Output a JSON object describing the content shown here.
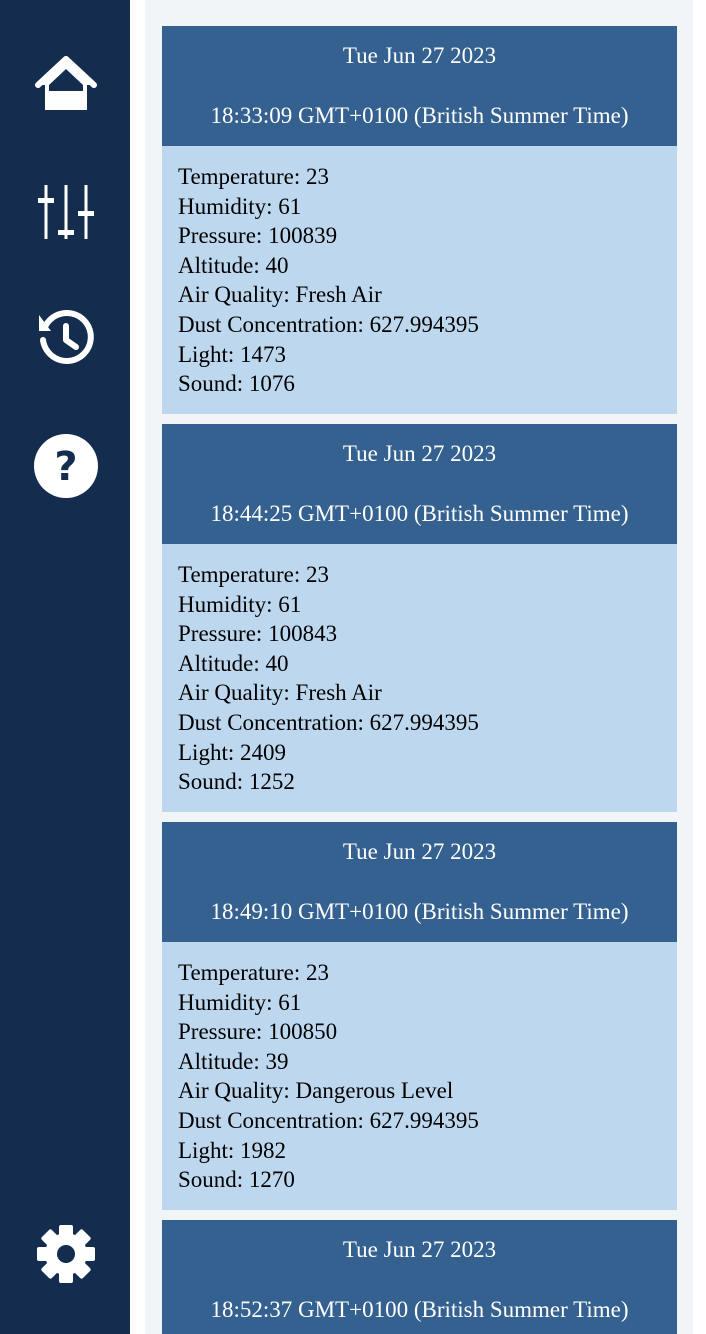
{
  "colors": {
    "sidebar": "#142d4e",
    "content_background": "#f1f5f8",
    "record_header": "#34618f",
    "record_body": "#bdd7ee"
  },
  "sidebar": {
    "items": [
      {
        "icon": "home-icon"
      },
      {
        "icon": "sliders-icon"
      },
      {
        "icon": "history-icon"
      },
      {
        "icon": "help-icon"
      },
      {
        "icon": "gear-icon"
      }
    ]
  },
  "records": [
    {
      "date": "Tue Jun 27 2023",
      "time": "18:33:09 GMT+0100 (British Summer Time)",
      "readings": {
        "temperature": "Temperature: 23",
        "humidity": "Humidity: 61",
        "pressure": "Pressure: 100839",
        "altitude": "Altitude: 40",
        "air_quality": "Air Quality: Fresh Air",
        "dust": "Dust Concentration: 627.994395",
        "light": "Light: 1473",
        "sound": "Sound: 1076"
      }
    },
    {
      "date": "Tue Jun 27 2023",
      "time": "18:44:25 GMT+0100 (British Summer Time)",
      "readings": {
        "temperature": "Temperature: 23",
        "humidity": "Humidity: 61",
        "pressure": "Pressure: 100843",
        "altitude": "Altitude: 40",
        "air_quality": "Air Quality: Fresh Air",
        "dust": "Dust Concentration: 627.994395",
        "light": "Light: 2409",
        "sound": "Sound: 1252"
      }
    },
    {
      "date": "Tue Jun 27 2023",
      "time": "18:49:10 GMT+0100 (British Summer Time)",
      "readings": {
        "temperature": "Temperature: 23",
        "humidity": "Humidity: 61",
        "pressure": "Pressure: 100850",
        "altitude": "Altitude: 39",
        "air_quality": "Air Quality: Dangerous Level",
        "dust": "Dust Concentration: 627.994395",
        "light": "Light: 1982",
        "sound": "Sound: 1270"
      }
    },
    {
      "date": "Tue Jun 27 2023",
      "time": "18:52:37 GMT+0100 (British Summer Time)"
    }
  ]
}
